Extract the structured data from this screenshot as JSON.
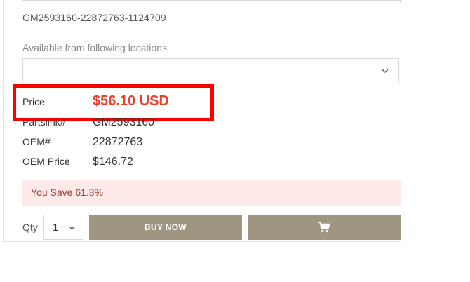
{
  "product": {
    "sku": "GM2593160-22872763-1124709"
  },
  "locations": {
    "label": "Available from following locations",
    "selected": ""
  },
  "pricing": {
    "price_label": "Price",
    "price_value": "$56.10 USD",
    "partslink_label": "Partslink#",
    "partslink_value": "GM2593160",
    "oem_label": "OEM#",
    "oem_value": "22872763",
    "oem_price_label": "OEM Price",
    "oem_price_value": "$146.72",
    "savings_text": "You Save 61.8%"
  },
  "purchase": {
    "qty_label": "Qty",
    "qty_value": "1",
    "buy_label": "BUY NOW",
    "cart_icon": "shopping-cart-icon"
  },
  "colors": {
    "price": "#e8402c",
    "highlight": "#ff0000",
    "savings_bg": "#fde9e7",
    "savings_text": "#a2382b",
    "button_bg": "#9e9680"
  }
}
